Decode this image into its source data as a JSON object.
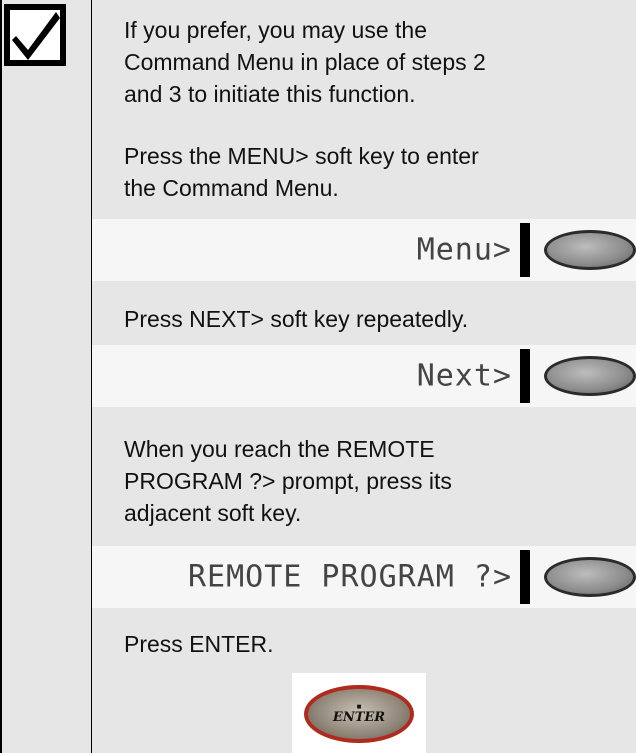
{
  "note": {
    "icon": "checkbox-checked-icon",
    "paragraphs": [
      "If you prefer, you may use the\nCommand Menu in place of steps 2\nand 3 to initiate this function.",
      "Press the MENU> soft key to enter\nthe Command Menu.",
      "Press NEXT> soft key repeatedly.",
      "When you reach the REMOTE\nPROGRAM ?> prompt, press its\nadjacent soft key.",
      "Press ENTER."
    ],
    "displays": [
      {
        "text": "Menu>",
        "key_icon": "soft-key-icon"
      },
      {
        "text": "Next>",
        "key_icon": "soft-key-icon"
      },
      {
        "text": "REMOTE PROGRAM ?>",
        "key_icon": "soft-key-icon"
      }
    ],
    "enter_key": {
      "label": "ENTER",
      "dot": "■",
      "icon": "enter-key-icon"
    }
  },
  "colors": {
    "panel_bg": "#e6e6e6",
    "lcd_bg": "#f6f6f6",
    "enter_ring": "#b02a1e"
  }
}
